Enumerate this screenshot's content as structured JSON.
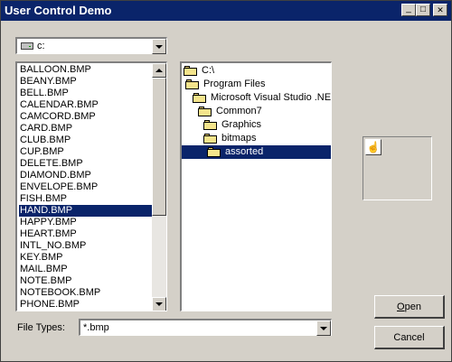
{
  "window": {
    "title": "User Control Demo",
    "controls": {
      "minimize": "_",
      "maximize": "□",
      "close": "✕"
    }
  },
  "drive": {
    "value": "c:",
    "icon": "drive-icon"
  },
  "files": {
    "items": [
      "BALLOON.BMP",
      "BEANY.BMP",
      "BELL.BMP",
      "CALENDAR.BMP",
      "CAMCORD.BMP",
      "CARD.BMP",
      "CLUB.BMP",
      "CUP.BMP",
      "DELETE.BMP",
      "DIAMOND.BMP",
      "ENVELOPE.BMP",
      "FISH.BMP",
      "HAND.BMP",
      "HAPPY.BMP",
      "HEART.BMP",
      "INTL_NO.BMP",
      "KEY.BMP",
      "MAIL.BMP",
      "NOTE.BMP",
      "NOTEBOOK.BMP",
      "PHONE.BMP"
    ],
    "selected": "HAND.BMP"
  },
  "dirs": {
    "items": [
      "C:\\",
      "Program Files",
      "Microsoft Visual Studio .NET",
      "Common7",
      "Graphics",
      "bitmaps",
      "assorted"
    ],
    "selected": "assorted"
  },
  "preview": {
    "icon": "hand-icon"
  },
  "file_types": {
    "label": "File Types:",
    "value": "*.bmp"
  },
  "buttons": {
    "open": "Open",
    "cancel": "Cancel"
  },
  "colors": {
    "selection": "#0a246a",
    "face": "#d4d0c8",
    "titlebar": "#0a246a"
  }
}
